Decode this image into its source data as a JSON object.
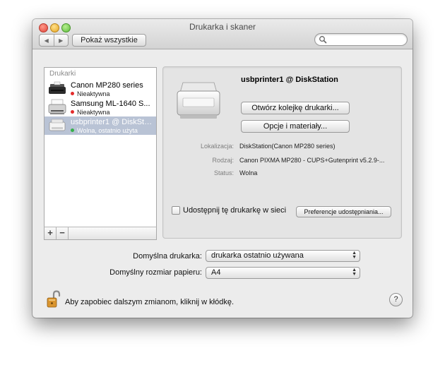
{
  "window": {
    "title": "Drukarka i skaner"
  },
  "toolbar": {
    "back_icon": "◀",
    "forward_icon": "▶",
    "show_all_label": "Pokaż wszystkie",
    "search_placeholder": ""
  },
  "printer_list": {
    "header": "Drukarki",
    "items": [
      {
        "name": "Canon MP280 series",
        "status": "Nieaktywna",
        "status_color": "#e32b2b",
        "selected": false
      },
      {
        "name": "Samsung ML-1640 S...",
        "status": "Nieaktywna",
        "status_color": "#e32b2b",
        "selected": false
      },
      {
        "name": "usbprinter1 @ DiskStat...",
        "status": "Wolna, ostatnio użyta",
        "status_color": "#36b04a",
        "selected": true
      }
    ],
    "add_label": "+",
    "remove_label": "−"
  },
  "detail": {
    "title": "usbprinter1 @ DiskStation",
    "open_queue_label": "Otwórz kolejkę drukarki...",
    "options_label": "Opcje i materiały...",
    "info": [
      {
        "label": "Lokalizacja:",
        "value": "DiskStation(Canon MP280 series)"
      },
      {
        "label": "Rodzaj:",
        "value": "Canon PIXMA MP280 - CUPS+Gutenprint v5.2.9-..."
      },
      {
        "label": "Status:",
        "value": "Wolna"
      }
    ],
    "share_label": "Udostępnij tę drukarkę w sieci",
    "share_checked": false,
    "sharing_prefs_label": "Preferencje udostępniania..."
  },
  "defaults": {
    "printer_label": "Domyślna drukarka:",
    "printer_value": "drukarka ostatnio używana",
    "paper_label": "Domyślny rozmiar papieru:",
    "paper_value": "A4"
  },
  "footer": {
    "lock_text": "Aby zapobiec dalszym zmianom, kliknij w kłódkę.",
    "help_label": "?"
  }
}
